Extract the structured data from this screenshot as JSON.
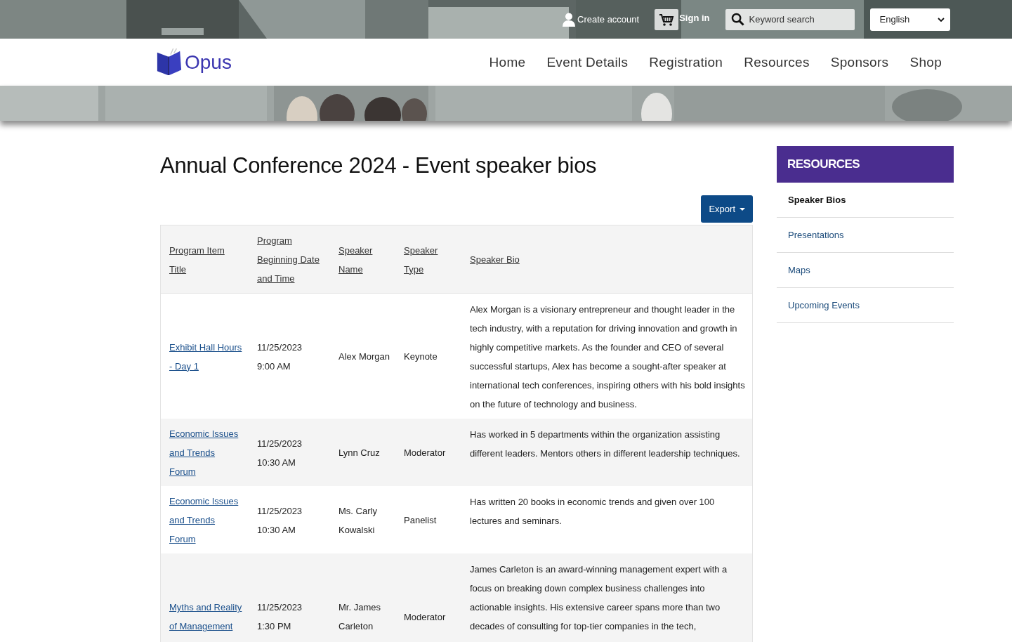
{
  "top_bar": {
    "create_account": "Create account",
    "sign_in": "Sign in",
    "search": {
      "placeholder": "Keyword search"
    },
    "language": "English"
  },
  "brand": {
    "name": "Opus"
  },
  "nav": [
    {
      "label": "Home"
    },
    {
      "label": "Event Details"
    },
    {
      "label": "Registration"
    },
    {
      "label": "Resources"
    },
    {
      "label": "Sponsors"
    },
    {
      "label": "Shop"
    }
  ],
  "page_title": "Annual Conference 2024 - Event speaker bios",
  "export_button": "Export",
  "table": {
    "columns": [
      "Program Item Title",
      "Program Beginning Date and Time",
      "Speaker Name",
      "Speaker Type",
      "Speaker Bio"
    ],
    "rows": [
      {
        "title": "Exhibit Hall Hours - Day 1",
        "date": "11/25/2023",
        "time": "9:00 AM",
        "name": "Alex Morgan",
        "type": "Keynote",
        "bio": "Alex Morgan is a visionary entrepreneur and thought leader in the tech industry, with a reputation for driving innovation and growth in highly competitive markets. As the founder and CEO of several successful startups, Alex has become a sought-after speaker at international tech conferences, inspiring others with his bold insights on the future of technology and business."
      },
      {
        "title": "Economic Issues and Trends Forum",
        "date": "11/25/2023",
        "time": "10:30 AM",
        "name": "Lynn Cruz",
        "type": "Moderator",
        "bio": "Has worked in 5 departments within the organization assisting different leaders. Mentors others in different leadership techniques."
      },
      {
        "title": "Economic Issues and Trends Forum",
        "date": "11/25/2023",
        "time": "10:30 AM",
        "name": "Ms. Carly Kowalski",
        "type": "Panelist",
        "bio": "Has written 20 books in economic trends and given over 100 lectures and seminars."
      },
      {
        "title": "Myths and Reality of Management",
        "date": "11/25/2023",
        "time": "1:30 PM",
        "name": "Mr. James Carleton",
        "type": "Moderator",
        "bio": "James Carleton is an award-winning management expert with a focus on breaking down complex business challenges into actionable insights. His extensive career spans more than two decades of consulting for top-tier companies in the tech,"
      }
    ]
  },
  "sidebar": {
    "heading": "RESOURCES",
    "items": [
      {
        "label": "Speaker Bios",
        "selected": true
      },
      {
        "label": "Presentations",
        "selected": false
      },
      {
        "label": "Maps",
        "selected": false
      },
      {
        "label": "Upcoming Events",
        "selected": false
      }
    ]
  }
}
